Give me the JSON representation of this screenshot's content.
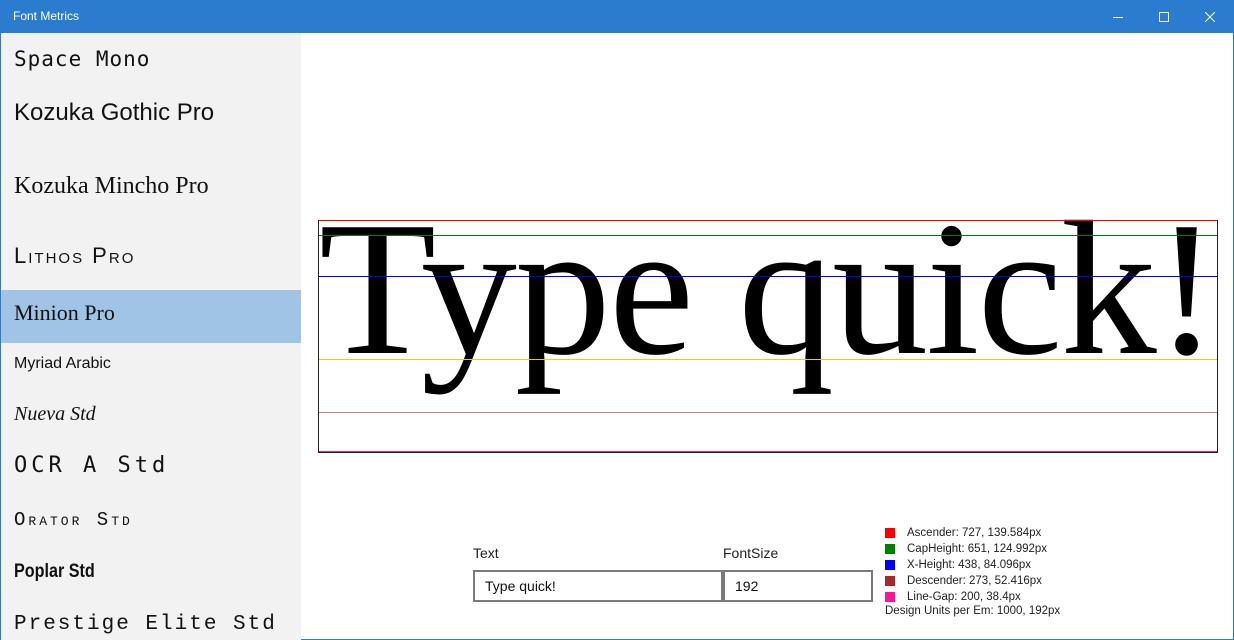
{
  "window": {
    "title": "Font Metrics"
  },
  "sidebar": {
    "items": [
      {
        "label": "Space Mono"
      },
      {
        "label": "Kozuka Gothic Pro"
      },
      {
        "label": "Kozuka Mincho Pro"
      },
      {
        "label": "Lithos Pro"
      },
      {
        "label": "Minion Pro",
        "selected": true
      },
      {
        "label": "Myriad Arabic"
      },
      {
        "label": "Nueva Std"
      },
      {
        "label": "OCR A Std"
      },
      {
        "label": "Orator Std"
      },
      {
        "label": "Poplar Std"
      },
      {
        "label": "Prestige Elite Std"
      }
    ]
  },
  "preview": {
    "sample_text": "Type quick!"
  },
  "controls": {
    "text_label": "Text",
    "text_value": "Type quick!",
    "fontsize_label": "FontSize",
    "fontsize_value": "192"
  },
  "legend": {
    "entries": [
      {
        "label": "Ascender: 727, 139.584px",
        "color": "#ff0000"
      },
      {
        "label": "CapHeight: 651, 124.992px",
        "color": "#008000"
      },
      {
        "label": "X-Height: 438, 84.096px",
        "color": "#0000ff"
      },
      {
        "label": "Descender: 273, 52.416px",
        "color": "#a52a2a"
      },
      {
        "label": "Line-Gap: 200, 38.4px",
        "color": "#ff1493"
      }
    ],
    "footer": "Design Units per Em: 1000, 192px"
  },
  "colors": {
    "titlebar": "#2b7ccf",
    "sidebar_bg": "#f2f2f2",
    "selected_bg": "#9fc4e6",
    "baseline": "#e6d200"
  }
}
